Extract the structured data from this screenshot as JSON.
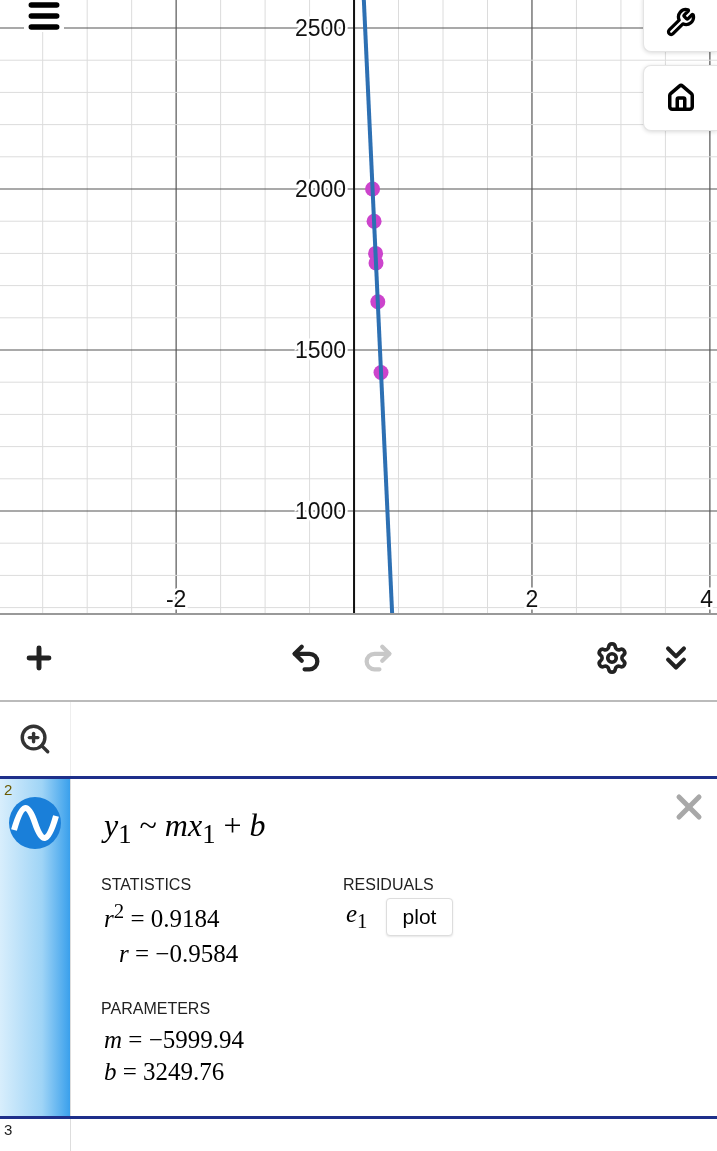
{
  "graph": {
    "chart_data": {
      "type": "scatter",
      "grid": true,
      "xlim": [
        -3.98,
        4.08
      ],
      "ylim": [
        677,
        2587
      ],
      "xticks": [
        -2,
        2,
        4
      ],
      "yticks": [
        1000,
        1500,
        2000,
        2500
      ],
      "series": [
        {
          "color": "#cc44cc",
          "x": [
            0.208,
            0.225,
            0.242,
            0.247,
            0.267,
            0.303
          ],
          "values": [
            2000,
            1900,
            1800,
            1770,
            1650,
            1430
          ]
        },
        {
          "type": "line",
          "color": "#2d70b3",
          "x": [
            0.11,
            0.429
          ],
          "values": [
            2587,
            677
          ]
        }
      ]
    }
  },
  "toolbar": [
    {
      "kind": "add",
      "disabled": false
    },
    {
      "kind": "undo",
      "disabled": false
    },
    {
      "kind": "redo",
      "disabled": true
    },
    {
      "kind": "settings",
      "disabled": false
    },
    {
      "kind": "collapse",
      "disabled": false
    }
  ],
  "expressions": [
    {
      "kind": "zoom"
    },
    {
      "kind": "regression",
      "index": "2",
      "selected": true,
      "formula": "*y*$_{1}$ ~ *mx*$_{1}$ + *b*",
      "statistics_label": "STATISTICS",
      "statistics": [
        "*r*$^{2}$ = 0.9184",
        "*r* = −0.9584"
      ],
      "residuals_label": "RESIDUALS",
      "residual": "*e*$_{1}$",
      "plot_button": "plot",
      "parameters_label": "PARAMETERS",
      "parameters": [
        "*m* = −5999.94",
        "*b* = 3249.76"
      ]
    },
    {
      "kind": "empty",
      "index": "3",
      "selected": false
    }
  ]
}
